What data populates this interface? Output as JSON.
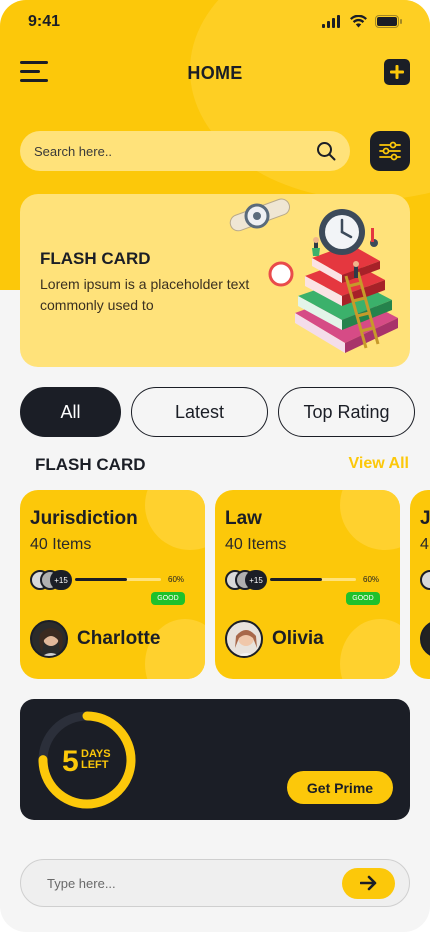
{
  "status": {
    "time": "9:41"
  },
  "header": {
    "title": "HOME"
  },
  "search": {
    "placeholder": "Search here.."
  },
  "banner": {
    "title": "FLASH CARD",
    "text": "Lorem ipsum is a placeholder text commonly used to"
  },
  "tabs": [
    {
      "label": "All",
      "active": true
    },
    {
      "label": "Latest",
      "active": false
    },
    {
      "label": "Top Rating",
      "active": false
    }
  ],
  "section": {
    "title": "FLASH CARD",
    "view_all": "View All"
  },
  "cards": [
    {
      "title": "Jurisdiction",
      "items": "40 Items",
      "extra": "+15",
      "progress_label": "60%",
      "progress": 0.6,
      "badge": "GOOD",
      "owner": "Charlotte"
    },
    {
      "title": "Law",
      "items": "40 Items",
      "extra": "+15",
      "progress_label": "60%",
      "progress": 0.6,
      "badge": "GOOD",
      "owner": "Olivia"
    },
    {
      "title": "J",
      "items": "4",
      "extra": "",
      "progress_label": "",
      "progress": 0,
      "badge": "",
      "owner": ""
    }
  ],
  "prime": {
    "days": "5",
    "days_label_1": "DAYS",
    "days_label_2": "LEFT",
    "button": "Get Prime",
    "ring_progress": 0.75
  },
  "composer": {
    "placeholder": "Type here..."
  },
  "colors": {
    "accent": "#fcc80a",
    "dark": "#1b1e26",
    "badge_green": "#1fc12b"
  }
}
